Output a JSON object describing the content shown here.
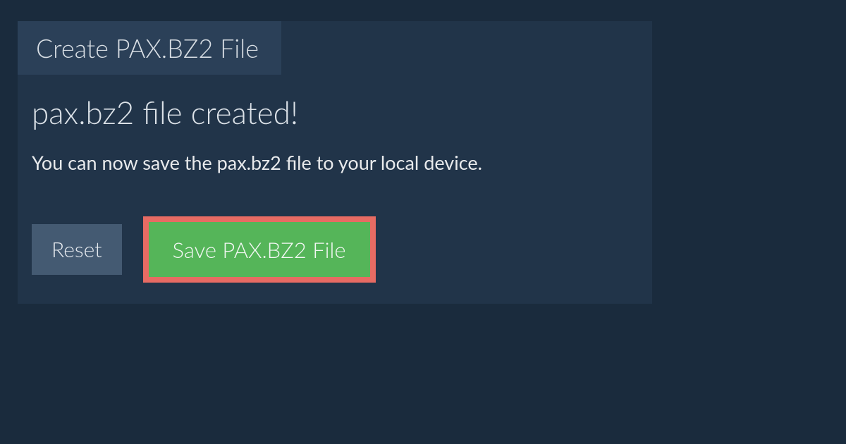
{
  "tab": {
    "label": "Create PAX.BZ2 File"
  },
  "content": {
    "heading": "pax.bz2 file created!",
    "description": "You can now save the pax.bz2 file to your local device."
  },
  "buttons": {
    "reset_label": "Reset",
    "save_label": "Save PAX.BZ2 File"
  }
}
